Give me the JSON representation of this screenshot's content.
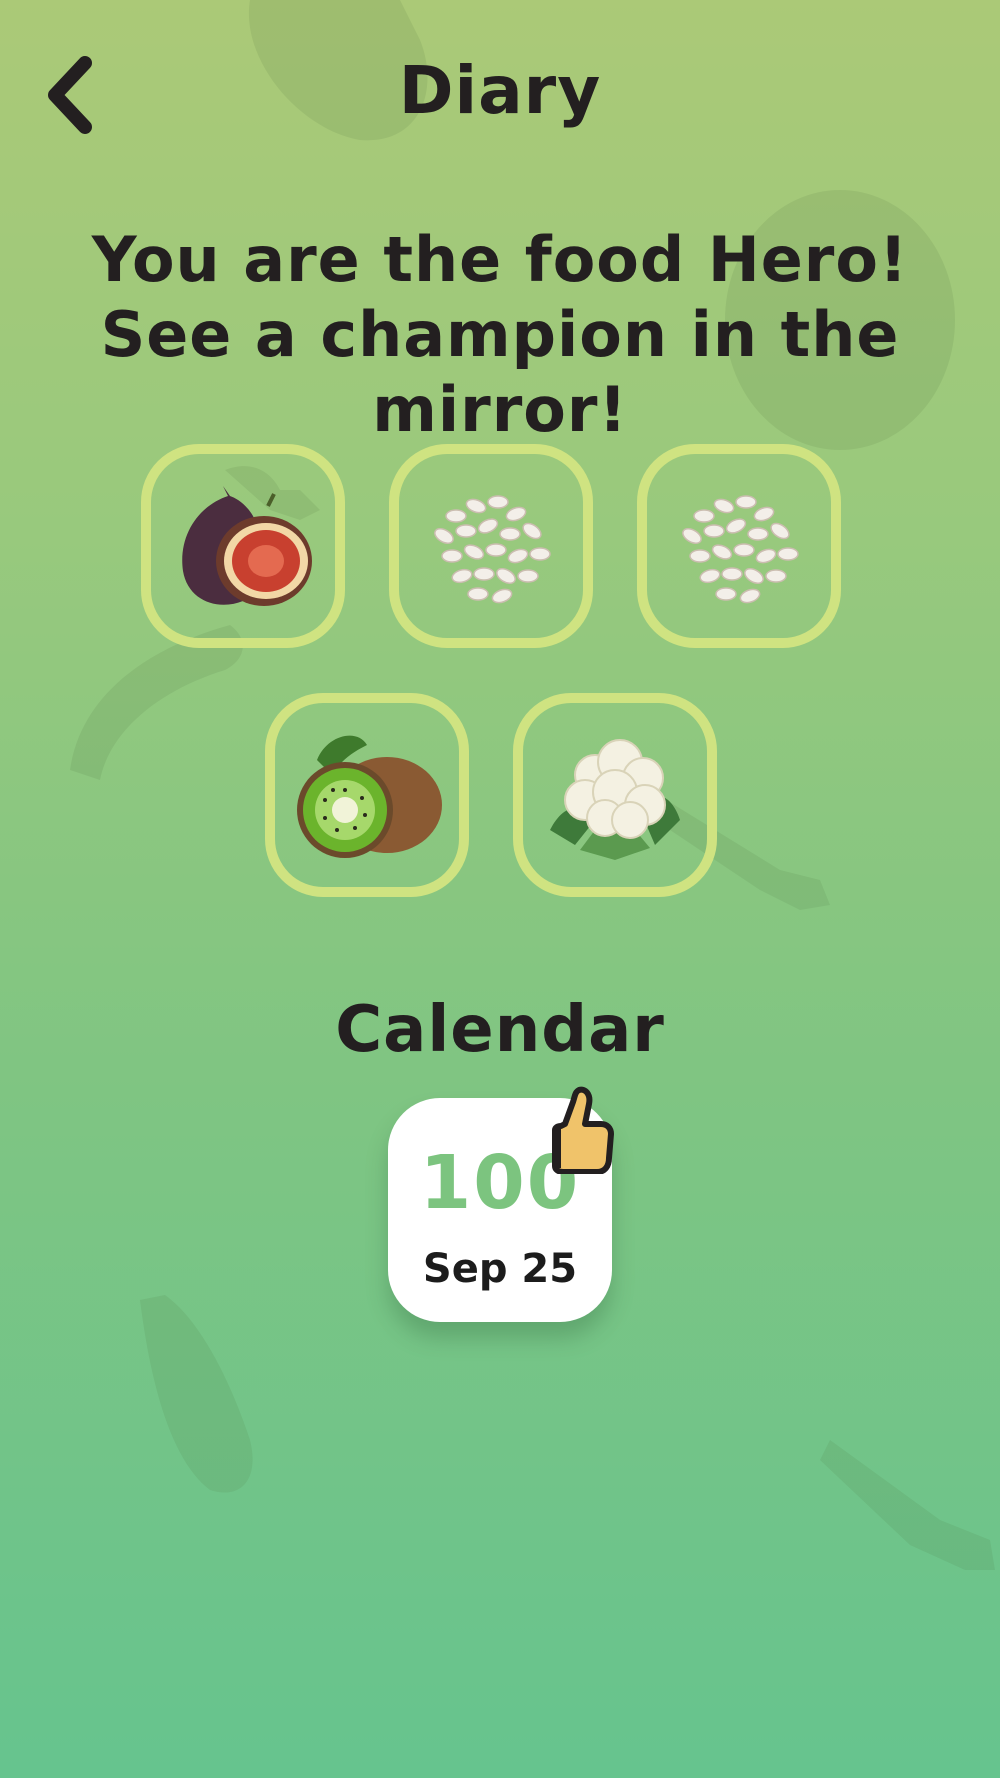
{
  "header": {
    "title": "Diary",
    "back_icon": "chevron-left-icon"
  },
  "headline": "You are the food Hero! See a champion in the mirror!",
  "foods": [
    {
      "name": "fig",
      "icon": "fig-icon"
    },
    {
      "name": "white beans",
      "icon": "white-beans-icon"
    },
    {
      "name": "white beans",
      "icon": "white-beans-icon"
    },
    {
      "name": "kiwi",
      "icon": "kiwi-icon"
    },
    {
      "name": "cauliflower",
      "icon": "cauliflower-icon"
    }
  ],
  "calendar": {
    "title": "Calendar",
    "entries": [
      {
        "score": "100",
        "date": "Sep 25",
        "badge": "thumbs-up-icon"
      }
    ]
  },
  "colors": {
    "background_top": "#abc977",
    "background_bottom": "#66c48e",
    "tile_border": "#cfe381",
    "score": "#7cc47f",
    "text": "#231f20"
  }
}
